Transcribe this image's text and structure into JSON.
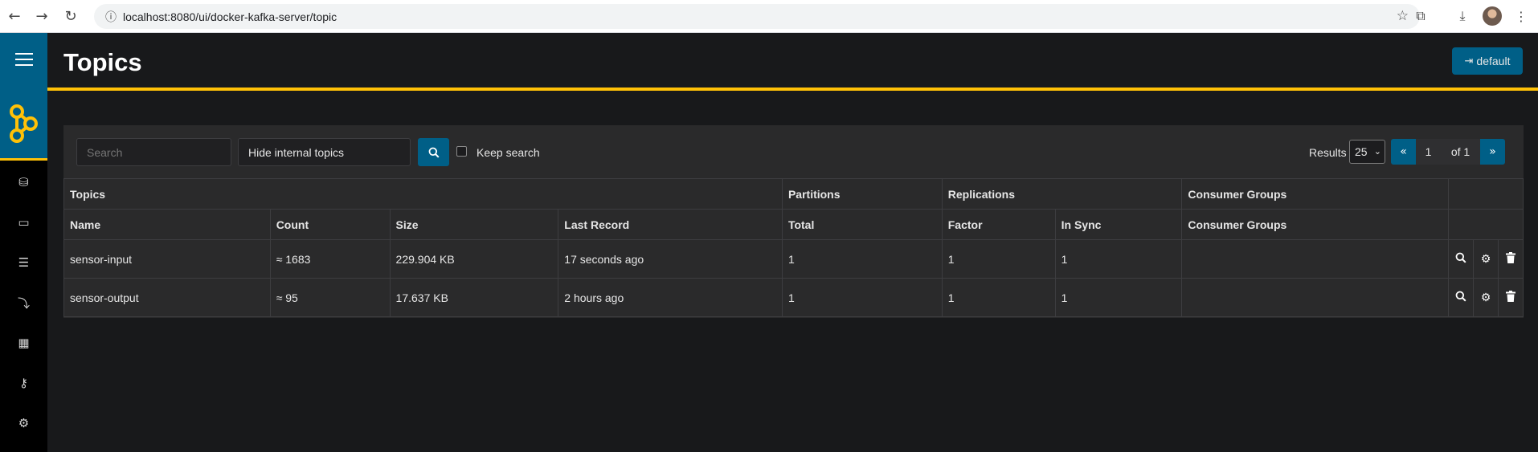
{
  "browser": {
    "url": "localhost:8080/ui/docker-kafka-server/topic"
  },
  "header": {
    "title": "Topics",
    "cluster_button": "default"
  },
  "filters": {
    "search_placeholder": "Search",
    "topic_filter": "Hide internal topics",
    "keep_search_label": "Keep search",
    "results_label": "Results",
    "page_size": "25",
    "pager": {
      "prev": "«",
      "page": "1",
      "of": "of 1",
      "next": "»"
    }
  },
  "table": {
    "groups": [
      "Topics",
      "Partitions",
      "Replications",
      "Consumer Groups"
    ],
    "columns": [
      "Name",
      "Count",
      "Size",
      "Last Record",
      "Total",
      "Factor",
      "In Sync",
      "Consumer Groups"
    ],
    "rows": [
      {
        "name": "sensor-input",
        "count": "≈ 1683",
        "size": "229.904 KB",
        "last_record": "17 seconds ago",
        "total": "1",
        "factor": "1",
        "in_sync": "1",
        "consumer_groups": ""
      },
      {
        "name": "sensor-output",
        "count": "≈ 95",
        "size": "17.637 KB",
        "last_record": "2 hours ago",
        "total": "1",
        "factor": "1",
        "in_sync": "1",
        "consumer_groups": ""
      }
    ]
  },
  "colors": {
    "accent": "#005f87",
    "highlight": "#ffc107",
    "background": "#18191b"
  }
}
